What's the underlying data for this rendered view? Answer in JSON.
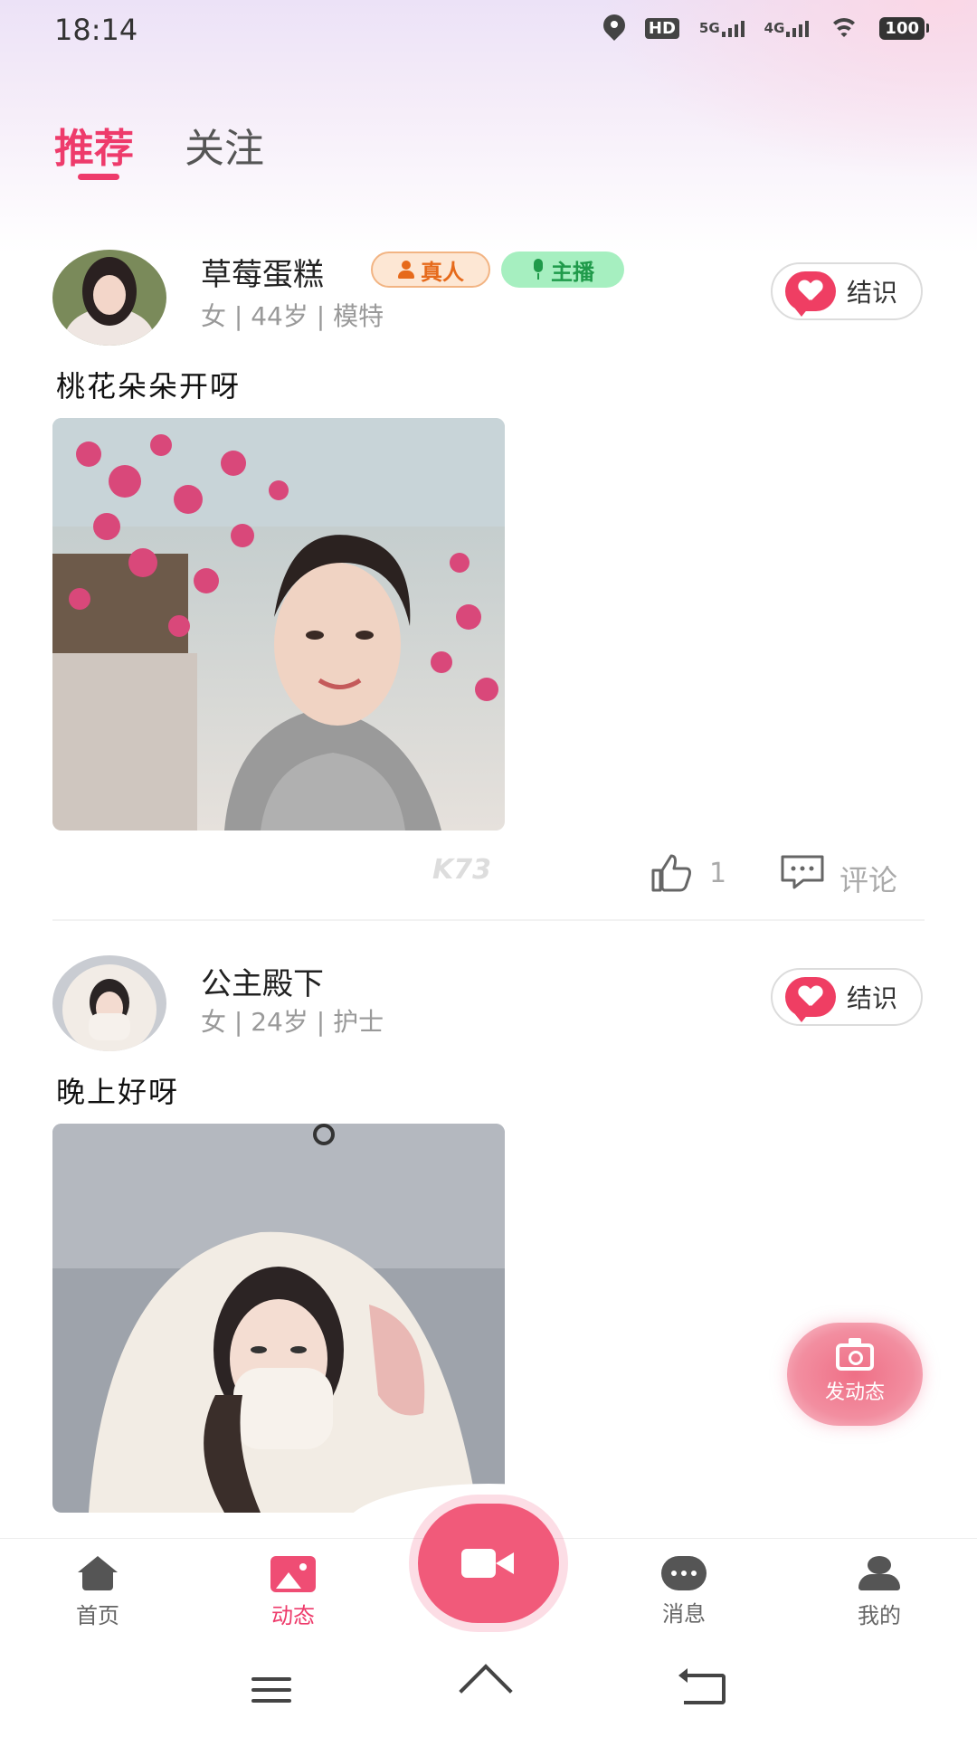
{
  "status_bar": {
    "time": "18:14",
    "hd_label": "HD",
    "net1": "5G",
    "net2": "4G",
    "battery": "100"
  },
  "tabs": [
    {
      "label": "推荐",
      "active": true
    },
    {
      "label": "关注",
      "active": false
    }
  ],
  "posts": [
    {
      "username": "草莓蛋糕",
      "badges": {
        "real": "真人",
        "anchor": "主播"
      },
      "meta": "女 | 44岁 | 模特",
      "meet_label": "结识",
      "text": "桃花朵朵开呀",
      "like_count": "1",
      "comment_label": "评论"
    },
    {
      "username": "公主殿下",
      "meta": "女 | 24岁 | 护士",
      "meet_label": "结识",
      "text": "晚上好呀"
    }
  ],
  "watermark": "K73",
  "fab": {
    "label": "发动态"
  },
  "bottom_nav": [
    {
      "label": "首页",
      "icon": "home-icon",
      "active": false
    },
    {
      "label": "动态",
      "icon": "moments-icon",
      "active": true
    },
    {
      "label": "消息",
      "icon": "message-icon",
      "active": false
    },
    {
      "label": "我的",
      "icon": "profile-icon",
      "active": false
    }
  ],
  "colors": {
    "accent": "#ee3b6b",
    "real_badge": "#e66a1b",
    "anchor_badge": "#1f9a4a"
  }
}
